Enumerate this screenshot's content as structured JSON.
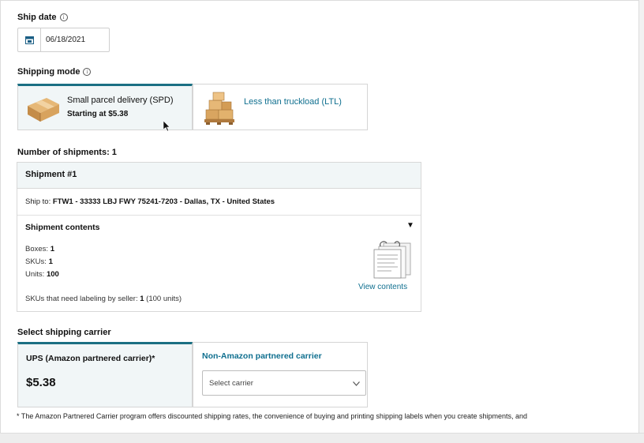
{
  "ship_date": {
    "label": "Ship date",
    "value": "06/18/2021",
    "icon": "calendar-icon"
  },
  "shipping_mode": {
    "label": "Shipping mode",
    "options": [
      {
        "name": "Small parcel delivery (SPD)",
        "price": "Starting at $5.38",
        "selected": true
      },
      {
        "name": "Less than truckload (LTL)",
        "selected": false
      }
    ]
  },
  "shipments": {
    "count_label": "Number of shipments: 1",
    "items": [
      {
        "title": "Shipment #1",
        "ship_to_prefix": "Ship to:",
        "ship_to": "FTW1 - 33333 LBJ FWY 75241-7203 - Dallas, TX - United States",
        "contents_title": "Shipment contents",
        "boxes_label": "Boxes:",
        "boxes": "1",
        "skus_label": "SKUs:",
        "skus": "1",
        "units_label": "Units:",
        "units": "100",
        "labeling_label": "SKUs that need labeling by seller:",
        "labeling_value": "1",
        "labeling_units": "(100 units)",
        "view_contents": "View contents"
      }
    ]
  },
  "carrier": {
    "label": "Select shipping carrier",
    "partnered": {
      "title": "UPS (Amazon partnered carrier)*",
      "price": "$5.38",
      "selected": true
    },
    "non_partnered": {
      "title": "Non-Amazon partnered carrier",
      "select_placeholder": "Select carrier"
    }
  },
  "footnote": "* The Amazon Partnered Carrier program offers discounted shipping rates, the convenience of buying and printing shipping labels when you create shipments, and",
  "colors": {
    "accent": "#1b6f83",
    "link": "#0f6f8f",
    "selected_bg": "#f1f6f7"
  }
}
